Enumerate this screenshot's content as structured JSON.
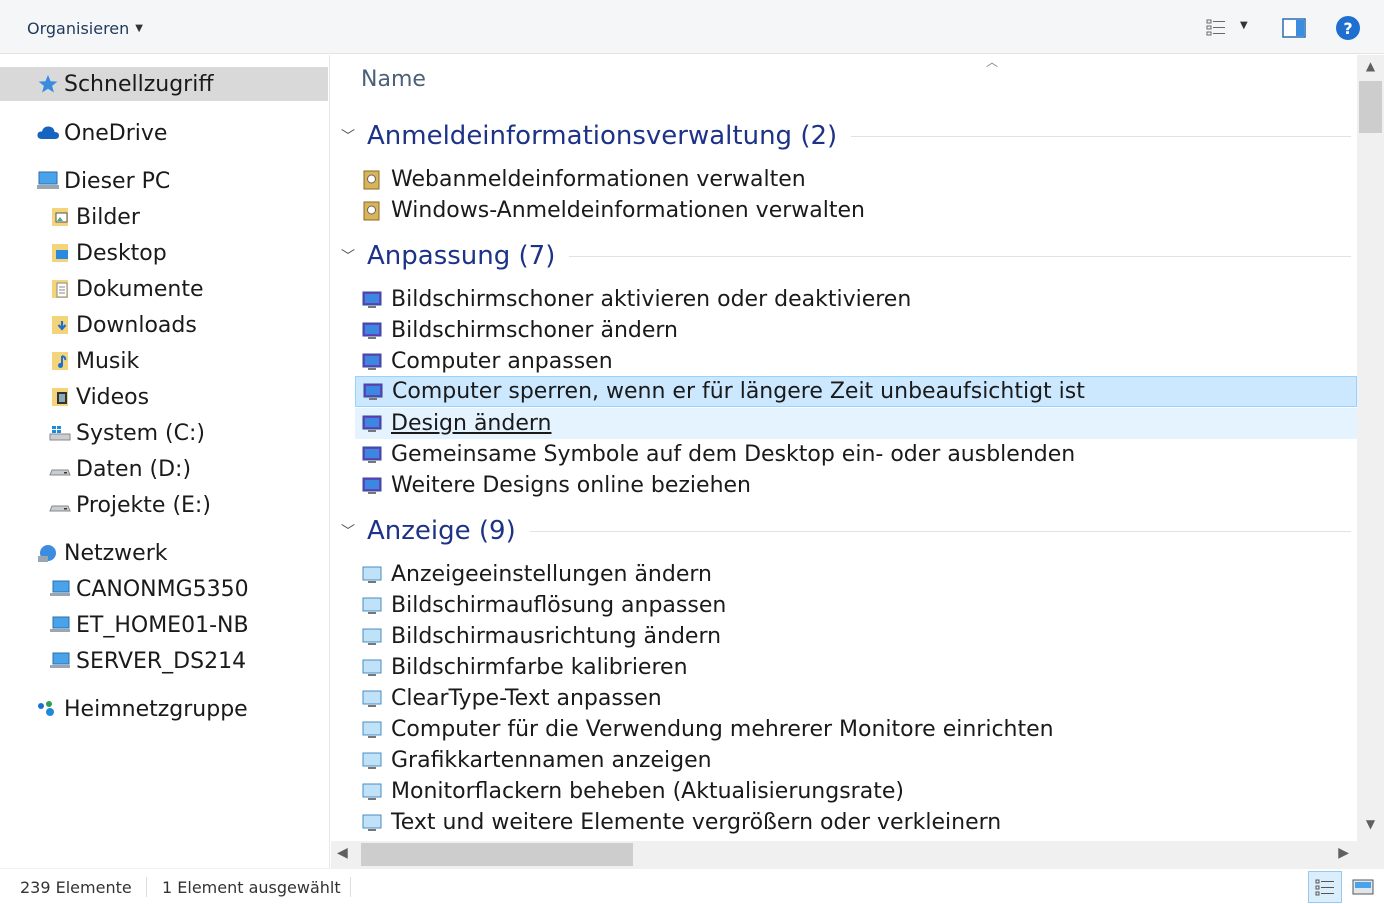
{
  "toolbar": {
    "organize_label": "Organisieren",
    "help_label": "?"
  },
  "nav": {
    "quick_access": "Schnellzugriff",
    "onedrive": "OneDrive",
    "this_pc": "Dieser PC",
    "pc_items": [
      "Bilder",
      "Desktop",
      "Dokumente",
      "Downloads",
      "Musik",
      "Videos",
      "System (C:)",
      "Daten (D:)",
      "Projekte (E:)"
    ],
    "network": "Netzwerk",
    "network_items": [
      "CANONMG5350",
      "ET_HOME01-NB",
      "SERVER_DS214"
    ],
    "homegroup": "Heimnetzgruppe"
  },
  "content": {
    "column_name": "Name",
    "groups": [
      {
        "title": "Anmeldeinformationsverwaltung (2)",
        "items": [
          "Webanmeldeinformationen verwalten",
          "Windows-Anmeldeinformationen verwalten"
        ]
      },
      {
        "title": "Anpassung (7)",
        "items": [
          "Bildschirmschoner aktivieren oder deaktivieren",
          "Bildschirmschoner ändern",
          "Computer anpassen",
          "Computer sperren, wenn er für längere Zeit unbeaufsichtigt ist",
          "Design ändern",
          "Gemeinsame Symbole auf dem Desktop ein- oder ausblenden",
          "Weitere Designs online beziehen"
        ]
      },
      {
        "title": "Anzeige (9)",
        "items": [
          "Anzeigeeinstellungen ändern",
          "Bildschirmauflösung anpassen",
          "Bildschirmausrichtung ändern",
          "Bildschirmfarbe kalibrieren",
          "ClearType-Text anpassen",
          "Computer für die Verwendung mehrerer Monitore einrichten",
          "Grafikkartennamen anzeigen",
          "Monitorflackern beheben (Aktualisierungsrate)",
          "Text und weitere Elemente vergrößern oder verkleinern"
        ]
      }
    ]
  },
  "status": {
    "count": "239 Elemente",
    "selection": "1 Element ausgewählt"
  },
  "colors": {
    "accent": "#1e3287",
    "selection_bg": "#cce8ff",
    "hover_bg": "#e5f3ff"
  }
}
